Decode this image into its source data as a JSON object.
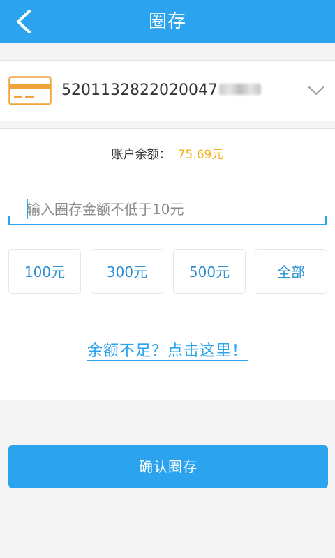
{
  "header": {
    "title": "圈存"
  },
  "card": {
    "number": "5201132822020047",
    "masked_suffix": "",
    "icon": "bank-card-icon",
    "dropdown_icon": "chevron-down-icon"
  },
  "balance": {
    "label": "账户余额：",
    "value": "75.69元"
  },
  "amount_input": {
    "value": "",
    "placeholder": "输入圈存金额不低于10元"
  },
  "quick_amounts": [
    {
      "label": "100元"
    },
    {
      "label": "300元"
    },
    {
      "label": "500元"
    },
    {
      "label": "全部"
    }
  ],
  "insufficient_link": "余额不足？点击这里！",
  "confirm_button": "确认圈存",
  "colors": {
    "primary": "#2ba3ee",
    "balance": "#f5b31b",
    "card_icon": "#f1a33b"
  }
}
